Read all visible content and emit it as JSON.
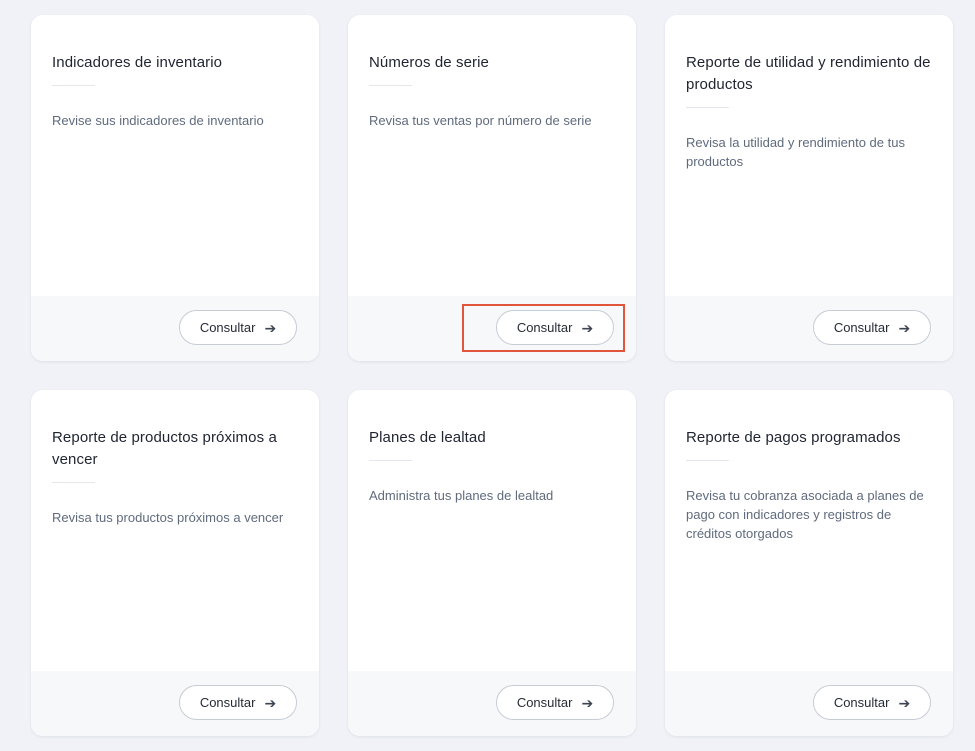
{
  "cards": [
    {
      "title": "Indicadores de inventario",
      "description": "Revise sus indicadores de inventario",
      "button_label": "Consultar"
    },
    {
      "title": "Números de serie",
      "description": "Revisa tus ventas por número de serie",
      "button_label": "Consultar"
    },
    {
      "title": "Reporte de utilidad y rendimiento de productos",
      "description": "Revisa la utilidad y rendimiento de tus productos",
      "button_label": "Consultar"
    },
    {
      "title": "Reporte de productos próximos a vencer",
      "description": "Revisa tus productos próximos a vencer",
      "button_label": "Consultar"
    },
    {
      "title": "Planes de lealtad",
      "description": "Administra tus planes de lealtad",
      "button_label": "Consultar"
    },
    {
      "title": "Reporte de pagos programados",
      "description": "Revisa tu cobranza asociada a planes de pago con indicadores y registros de créditos otorgados",
      "button_label": "Consultar"
    }
  ],
  "icons": {
    "button_icon": "arrow-right-icon",
    "button_glyph": "➔"
  },
  "colors": {
    "background": "#f0f2f7",
    "card": "#ffffff",
    "footer": "#f7f8fa",
    "highlight": "#e2553d"
  }
}
